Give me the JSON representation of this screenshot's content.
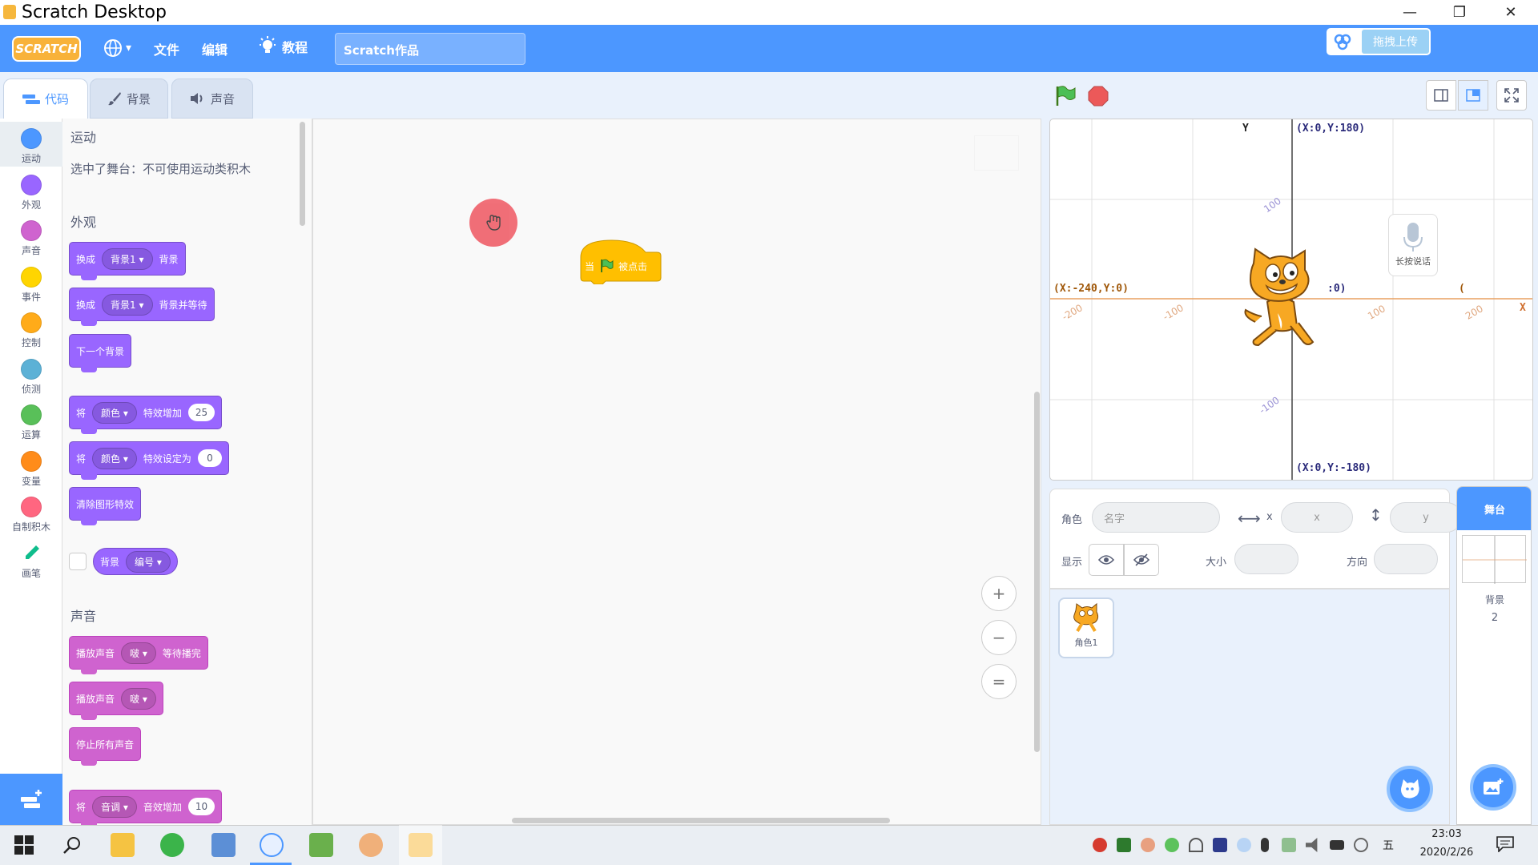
{
  "window": {
    "title": "Scratch Desktop",
    "minimize": "—",
    "restore": "❐",
    "close": "✕"
  },
  "menubar": {
    "logo": "SCRATCH",
    "globe_caret": "▾",
    "file": "文件",
    "edit": "编辑",
    "tutorials": "教程",
    "project_name": "Scratch作品",
    "upload": "拖拽上传"
  },
  "tabs": {
    "code": "代码",
    "backdrops": "背景",
    "sounds": "声音"
  },
  "categories": [
    {
      "label": "运动",
      "color": "#4c97ff"
    },
    {
      "label": "外观",
      "color": "#9966ff"
    },
    {
      "label": "声音",
      "color": "#cf63cf"
    },
    {
      "label": "事件",
      "color": "#ffd500"
    },
    {
      "label": "控制",
      "color": "#ffab19"
    },
    {
      "label": "侦测",
      "color": "#5cb1d6"
    },
    {
      "label": "运算",
      "color": "#59c059"
    },
    {
      "label": "变量",
      "color": "#ff8c1a"
    },
    {
      "label": "自制积木",
      "color": "#ff6680"
    },
    {
      "label": "画笔",
      "color": "#0fbd8c"
    }
  ],
  "palette": {
    "motion_header": "运动",
    "motion_note": "选中了舞台：不可使用运动类积木",
    "looks_header": "外观",
    "sound_header": "声音",
    "looks_blocks": {
      "switch_prefix": "换成",
      "switch_dd": "背景1",
      "switch_suffix": "背景",
      "switch_wait_prefix": "换成",
      "switch_wait_dd": "背景1",
      "switch_wait_suffix": "背景并等待",
      "next_backdrop": "下一个背景",
      "change_effect_prefix": "将",
      "change_effect_dd": "颜色",
      "change_effect_mid": "特效增加",
      "change_effect_val": "25",
      "set_effect_prefix": "将",
      "set_effect_dd": "颜色",
      "set_effect_mid": "特效设定为",
      "set_effect_val": "0",
      "clear_effects": "清除图形特效",
      "reporter_label": "背景",
      "reporter_dd": "编号"
    },
    "sound_blocks": {
      "play_wait_prefix": "播放声音",
      "play_wait_dd": "啵",
      "play_wait_suffix": "等待播完",
      "play_prefix": "播放声音",
      "play_dd": "啵",
      "stop_all": "停止所有声音",
      "change_prefix": "将",
      "change_dd": "音调",
      "change_mid": "音效增加",
      "change_val": "10"
    }
  },
  "script": {
    "hat_when": "当",
    "hat_clicked": "被点击"
  },
  "zoom": {
    "in": "+",
    "out": "−",
    "reset": "="
  },
  "stage": {
    "top_coord": "(X:0,Y:180)",
    "bottom_coord": "(X:0,Y:-180)",
    "left_coord": "(X:-240,Y:0)",
    "right_partial": ":0)",
    "right_clipped": "(",
    "y_axis_label": "Y",
    "x_axis_label": "X",
    "tick_labels": {
      "y_pos": "100",
      "y_neg": "-100",
      "x_neg200": "-200",
      "x_neg100": "-100",
      "x_pos100": "100",
      "x_pos200": "200"
    },
    "voice_label": "长按说话"
  },
  "sprite_info": {
    "sprite_label": "角色",
    "name_placeholder": "名字",
    "x_label": "x",
    "x_placeholder": "x",
    "y_label": "y",
    "y_placeholder": "y",
    "show_label": "显示",
    "size_label": "大小",
    "direction_label": "方向"
  },
  "sprites": [
    {
      "name": "角色1"
    }
  ],
  "stage_panel": {
    "header": "舞台",
    "backdrops_label": "背景",
    "backdrops_count": "2"
  },
  "taskbar": {
    "time": "23:03",
    "date": "2020/2/26",
    "ime": "五"
  }
}
